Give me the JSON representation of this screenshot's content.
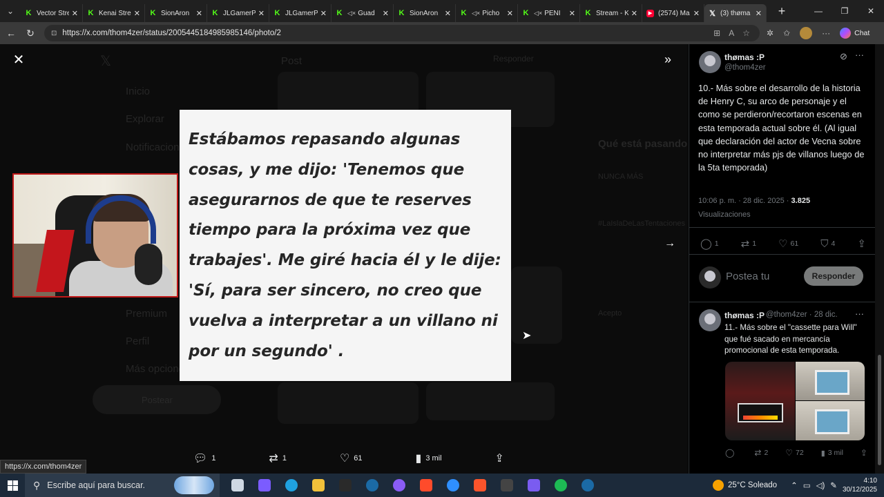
{
  "browser": {
    "tabs": [
      {
        "title": "Vector Stre",
        "icon": "kick-icon",
        "muted": false
      },
      {
        "title": "Kenai Strea",
        "icon": "kick-icon",
        "muted": false
      },
      {
        "title": "SionAron",
        "icon": "kick-icon",
        "muted": false
      },
      {
        "title": "JLGamerP",
        "icon": "kick-icon",
        "muted": false
      },
      {
        "title": "JLGamerP",
        "icon": "kick-icon",
        "muted": false
      },
      {
        "title": "Guad",
        "icon": "kick-icon",
        "muted": true
      },
      {
        "title": "SionAron",
        "icon": "kick-icon",
        "muted": false
      },
      {
        "title": "Picho",
        "icon": "kick-icon",
        "muted": true
      },
      {
        "title": "PENI",
        "icon": "kick-icon",
        "muted": true
      },
      {
        "title": "Stream - K",
        "icon": "kick-icon",
        "muted": false
      },
      {
        "title": "(2574) Ma",
        "icon": "youtube-icon",
        "muted": false
      },
      {
        "title": "(3) thøma",
        "icon": "x-icon",
        "muted": false,
        "active": true
      }
    ],
    "url": "https://x.com/thom4zer/status/2005445184985985146/photo/2",
    "chat_label": "Chat",
    "status_url": "https://x.com/thom4zer"
  },
  "viewer": {
    "photo_lines": [
      "Estábamos repasando algunas",
      "cosas, y me dijo: 'Tenemos que",
      "asegurarnos de que te reserves",
      "tiempo para la próxima vez que",
      "trabajes'. Me giré hacia él y le dije:",
      "'Sí, para ser sincero, no creo que",
      "vuelva a interpretar a un villano ni",
      "por un segundo' ."
    ],
    "actions": {
      "replies": "1",
      "reposts": "1",
      "likes": "61",
      "views": "3 mil"
    },
    "background_ghost": {
      "post_label": "Post",
      "reply_label": "Responder",
      "nav": [
        "Inicio",
        "Explorar",
        "Notificaciones",
        "Premium",
        "Perfil",
        "Más opciones"
      ],
      "post_button": "Postear",
      "trending_title": "Qué está pasando",
      "trend1": "NUNCA MÁS",
      "trend2": "#LaIslaDeLasTentaciones",
      "trend3": "Acepto"
    }
  },
  "panel": {
    "post": {
      "name": "thømas :P",
      "handle": "@thom4zer",
      "text": "10.- Más sobre el desarrollo de la historia de Henry C, su arco de personaje y el como se perdieron/recortaron escenas en esta temporada actual sobre él. (Al igual que declaración del actor de Vecna sobre no interpretar más pjs de villanos luego de la 5ta temporada)",
      "timestamp": "10:06 p. m. · 28 dic. 2025 · ",
      "views_count": "3.825",
      "views_label": "Visualizaciones",
      "replies": "1",
      "reposts": "1",
      "likes": "61",
      "bookmarks": "4"
    },
    "reply_box": {
      "placeholder": "Postea tu",
      "button": "Responder"
    },
    "next_post": {
      "name": "thømas :P",
      "handle_date": "@thom4zer · 28 dic.",
      "text": "11.- Más sobre el \"cassette para Will\" que fué sacado en mercancía promocional de esta temporada.",
      "replies": "",
      "reposts": "2",
      "likes": "72",
      "views": "3 mil"
    }
  },
  "taskbar": {
    "search_placeholder": "Escribe aquí para buscar.",
    "weather": "25°C  Soleado",
    "time": "4:10",
    "date": "30/12/2025",
    "apps": [
      {
        "name": "task-view",
        "color": "#cfd8e3"
      },
      {
        "name": "copilot",
        "color": "#7b5cff"
      },
      {
        "name": "edge",
        "color": "#1fa1e0"
      },
      {
        "name": "file-explorer",
        "color": "#f2c13a"
      },
      {
        "name": "epic-games",
        "color": "#2a2a2a"
      },
      {
        "name": "steam",
        "color": "#1b6aa5"
      },
      {
        "name": "discord-like",
        "color": "#8a5cf6"
      },
      {
        "name": "ea",
        "color": "#ff4b2b"
      },
      {
        "name": "battlenet",
        "color": "#2f8fff"
      },
      {
        "name": "brave",
        "color": "#fb542b"
      },
      {
        "name": "obs",
        "color": "#444"
      },
      {
        "name": "launcher",
        "color": "#7a5cf0"
      },
      {
        "name": "spotify",
        "color": "#1db954"
      },
      {
        "name": "steam-2",
        "color": "#1b6aa5"
      }
    ]
  },
  "colors": {
    "accent": "#1d9bf0",
    "kick_green": "#53fc18",
    "text_primary": "#e7e9ea",
    "text_secondary": "#71767b"
  }
}
